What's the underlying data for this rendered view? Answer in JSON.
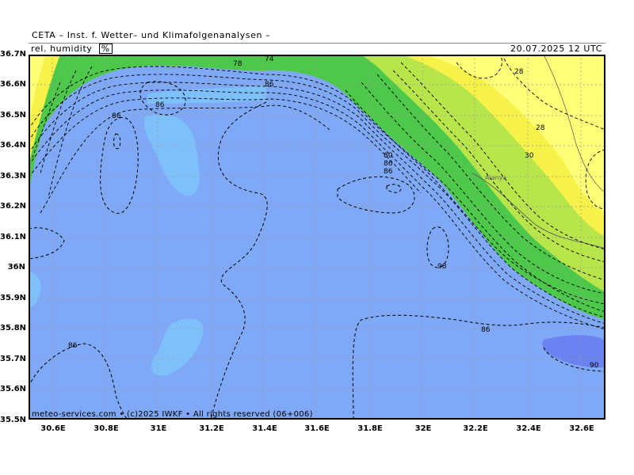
{
  "header": {
    "title": "CETA – Inst. f. Wetter– und Klimafolgenanalysen –",
    "parameter": "rel. humidity",
    "unit": "%",
    "datetime": "20.07.2025 12 UTC"
  },
  "footer": {
    "credit": "meteo-services.com • (c)2025 IWKF • All rights reserved (06+006)"
  },
  "axes": {
    "lat_labels": [
      "36.7N",
      "36.6N",
      "36.5N",
      "36.4N",
      "36.3N",
      "36.2N",
      "36.1N",
      "36N",
      "35.9N",
      "35.8N",
      "35.7N",
      "35.6N",
      "35.5N"
    ],
    "lon_labels": [
      "30.6E",
      "30.8E",
      "31E",
      "31.2E",
      "31.4E",
      "31.6E",
      "31.8E",
      "32E",
      "32.2E",
      "32.4E",
      "32.6E"
    ]
  },
  "map": {
    "place_label": "Alanya",
    "contour_labels": [
      "78",
      "74",
      "86",
      "86",
      "86",
      "86",
      "28",
      "28",
      "30",
      "80",
      "86",
      "98",
      "86",
      "90",
      "86"
    ],
    "colors": {
      "sea": "#7fa9f7",
      "sea_light": "#7ec0fc",
      "sea_dark": "#6b83f0",
      "green": "#22c33a",
      "yellow_green": "#b8e64a",
      "yellow": "#ffff77",
      "yellow_strong": "#f6f24a"
    }
  }
}
